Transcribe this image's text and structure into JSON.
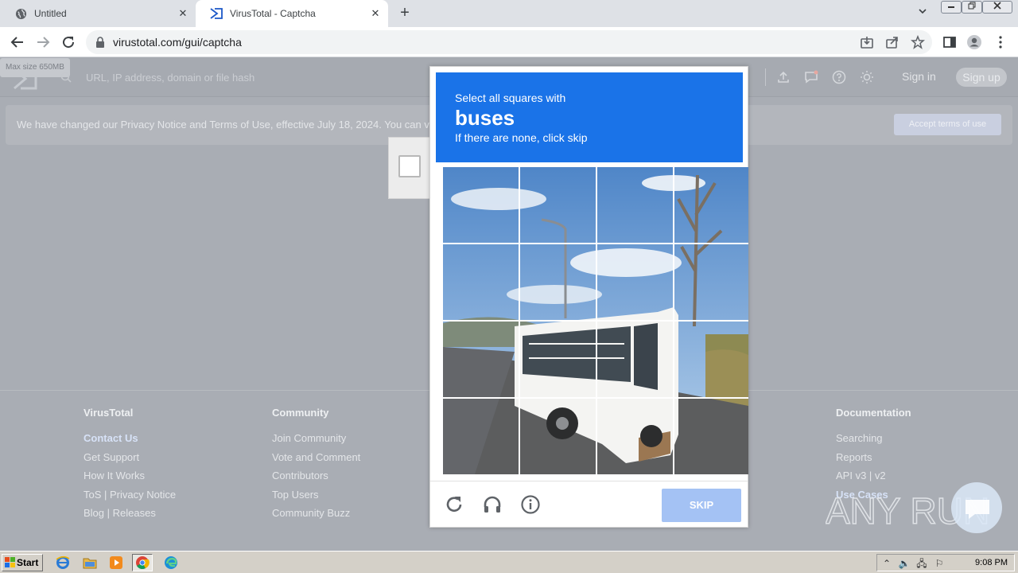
{
  "browser": {
    "tabs": [
      {
        "title": "Untitled",
        "active": false
      },
      {
        "title": "VirusTotal - Captcha",
        "active": true
      }
    ],
    "url": "virustotal.com/gui/captcha",
    "new_tab_glyph": "+",
    "tab_close_glyph": "✕"
  },
  "page": {
    "max_size_tip": "Max size 650MB",
    "search_placeholder": "URL, IP address, domain or file hash",
    "sign_in": "Sign in",
    "sign_up": "Sign up",
    "privacy_banner": "We have changed our Privacy Notice and Terms of Use, effective July 18, 2024. You can v",
    "accept_terms": "Accept terms of use"
  },
  "footer": {
    "columns": [
      {
        "heading": "VirusTotal",
        "links": [
          "Contact Us",
          "Get Support",
          "How It Works",
          "ToS | Privacy Notice",
          "Blog | Releases"
        ]
      },
      {
        "heading": "Community",
        "links": [
          "Join Community",
          "Vote and Comment",
          "Contributors",
          "Top Users",
          "Community Buzz"
        ]
      },
      {
        "heading": "Documentation",
        "links": [
          "Searching",
          "Reports",
          "API v3 | v2",
          "Use Cases"
        ]
      }
    ]
  },
  "captcha": {
    "instruction_line1": "Select all squares with",
    "target": "buses",
    "instruction_line3": "If there are none, click skip",
    "skip_label": "SKIP",
    "icons": [
      "reload-icon",
      "audio-icon",
      "info-icon"
    ],
    "grid_rows": 4,
    "grid_cols": 4
  },
  "watermark": "ANY RUN",
  "taskbar": {
    "start_label": "Start",
    "clock": "9:08 PM"
  },
  "colors": {
    "captcha_header": "#1a73e8",
    "skip_button": "#a4c2f4",
    "overlay_page": "#a9adb4"
  }
}
